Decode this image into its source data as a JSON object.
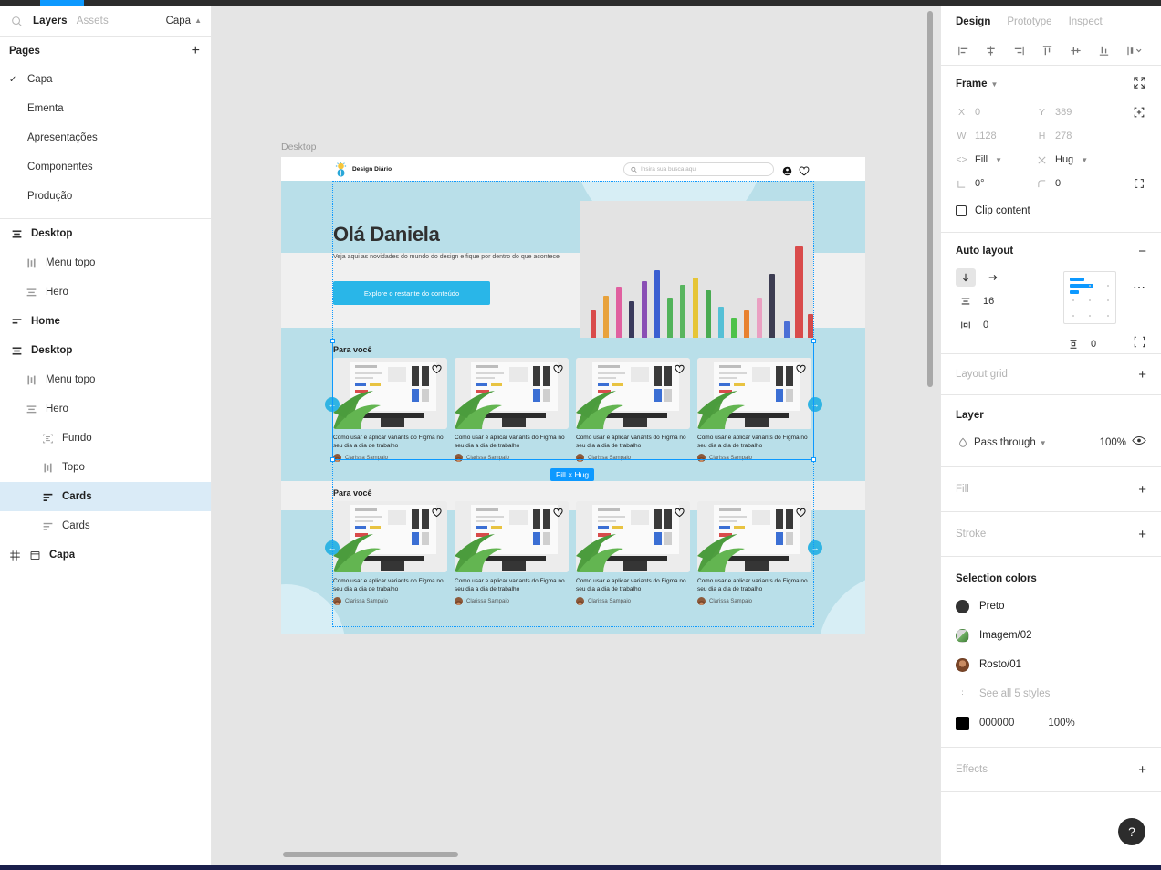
{
  "app": {
    "left_panel": {
      "tabs": [
        {
          "label": "Layers",
          "selected": true
        },
        {
          "label": "Assets",
          "selected": false
        }
      ],
      "page_selector": "Capa",
      "search_icon": "search-icon",
      "pages_title": "Pages",
      "add_page_icon": "plus-icon",
      "pages": [
        {
          "label": "Capa",
          "checked": true
        },
        {
          "label": "Ementa",
          "checked": false
        },
        {
          "label": "Apresentações",
          "checked": false
        },
        {
          "label": "Componentes",
          "checked": false
        },
        {
          "label": "Produção",
          "checked": false
        }
      ],
      "layers": [
        {
          "label": "Desktop",
          "indent": 0,
          "icon": "auto-layout-vertical-icon",
          "bold": true,
          "selected": false
        },
        {
          "label": "Menu topo",
          "indent": 1,
          "icon": "auto-layout-horizontal-icon",
          "bold": false,
          "selected": false
        },
        {
          "label": "Hero",
          "indent": 1,
          "icon": "auto-layout-vertical-icon",
          "bold": false,
          "selected": false
        },
        {
          "label": "Home",
          "indent": 0,
          "icon": "auto-layout-vertical-icon",
          "bold": true,
          "selected": false
        },
        {
          "label": "Desktop",
          "indent": 0,
          "icon": "auto-layout-vertical-icon",
          "bold": true,
          "selected": false
        },
        {
          "label": "Menu topo",
          "indent": 1,
          "icon": "auto-layout-horizontal-icon",
          "bold": false,
          "selected": false
        },
        {
          "label": "Hero",
          "indent": 1,
          "icon": "auto-layout-vertical-icon",
          "bold": false,
          "selected": false
        },
        {
          "label": "Fundo",
          "indent": 2,
          "icon": "component-icon",
          "bold": false,
          "selected": false
        },
        {
          "label": "Topo",
          "indent": 2,
          "icon": "auto-layout-horizontal-icon",
          "bold": false,
          "selected": false
        },
        {
          "label": "Cards",
          "indent": 2,
          "icon": "auto-layout-vertical-icon",
          "bold": true,
          "selected": true
        },
        {
          "label": "Cards",
          "indent": 2,
          "icon": "auto-layout-vertical-icon",
          "bold": false,
          "selected": false
        },
        {
          "label": "Capa",
          "indent": 0,
          "icon": "grid-frame-icon",
          "bold": true,
          "selected": false
        }
      ]
    },
    "canvas": {
      "frame_label": "Desktop",
      "fill_hug_badge": "Fill × Hug",
      "site": {
        "logo_text": "Design Diário",
        "search_placeholder": "Insira sua busca aqui",
        "search_icon": "search-icon",
        "account_icon": "account-circle-icon",
        "favorite_icon": "heart-icon",
        "hero_title": "Olá Daniela",
        "hero_subtitle": "Veja aqui as novidades do mundo do design e fique por dentro do que acontece",
        "hero_cta": "Explore o restante do conteúdo",
        "sections": [
          {
            "title": "Para você",
            "cards": [
              {
                "title": "Como usar e aplicar variants do Figma no seu dia a dia de trabalho",
                "author": "Clarissa Sampaio"
              },
              {
                "title": "Como usar e aplicar variants do Figma no seu dia a dia de trabalho",
                "author": "Clarissa Sampaio"
              },
              {
                "title": "Como usar e aplicar variants do Figma no seu dia a dia de trabalho",
                "author": "Clarissa Sampaio"
              },
              {
                "title": "Como usar e aplicar variants do Figma no seu dia a dia de trabalho",
                "author": "Clarissa Sampaio"
              }
            ],
            "prev_arrow": "←",
            "next_arrow": "→"
          },
          {
            "title": "Para você",
            "cards": [
              {
                "title": "Como usar e aplicar variants do Figma no seu dia a dia de trabalho",
                "author": "Clarissa Sampaio"
              },
              {
                "title": "Como usar e aplicar variants do Figma no seu dia a dia de trabalho",
                "author": "Clarissa Sampaio"
              },
              {
                "title": "Como usar e aplicar variants do Figma no seu dia a dia de trabalho",
                "author": "Clarissa Sampaio"
              },
              {
                "title": "Como usar e aplicar variants do Figma no seu dia a dia de trabalho",
                "author": "Clarissa Sampaio"
              }
            ],
            "prev_arrow": "←",
            "next_arrow": "→"
          }
        ]
      }
    },
    "right_panel": {
      "tabs": [
        {
          "label": "Design",
          "selected": true
        },
        {
          "label": "Prototype",
          "selected": false
        },
        {
          "label": "Inspect",
          "selected": false
        }
      ],
      "align_icons": [
        "align-left-icon",
        "align-horizontal-center-icon",
        "align-right-icon",
        "align-top-icon",
        "align-vertical-center-icon",
        "align-bottom-icon",
        "distribute-icon"
      ],
      "frame": {
        "title": "Frame",
        "collapse_icon": "collapse-icon",
        "x_key": "X",
        "x_val": "0",
        "y_key": "Y",
        "y_val": "389",
        "w_key": "W",
        "w_val": "1128",
        "h_key": "H",
        "h_val": "278",
        "resize_icon": "resize-to-fit-icon",
        "horizontal_resizing": "Fill",
        "vertical_resizing": "Hug",
        "rotation": "0°",
        "corner_radius": "0",
        "independent_corners_icon": "independent-corners-icon",
        "clip_content": "Clip content",
        "clip_content_checked": false
      },
      "auto_layout": {
        "title": "Auto layout",
        "remove_icon": "minus-icon",
        "direction_vertical_icon": "arrow-down-icon",
        "direction_horizontal_icon": "arrow-right-icon",
        "direction_selected": "vertical",
        "gap_icon": "spacing-icon",
        "gap": "16",
        "padding_h_icon": "horizontal-padding-icon",
        "padding_h": "0",
        "padding_v_icon": "vertical-padding-icon",
        "padding_v": "0",
        "more_icon": "more-options-icon",
        "stroke_mode_icon": "clip-content-icon"
      },
      "layout_grid": {
        "title": "Layout grid",
        "add_icon": "plus-icon"
      },
      "layer": {
        "title": "Layer",
        "blend_mode_icon": "blend-mode-icon",
        "blend_mode": "Pass through",
        "opacity": "100%",
        "visibility_icon": "eye-icon"
      },
      "fill": {
        "title": "Fill",
        "add_icon": "plus-icon"
      },
      "stroke": {
        "title": "Stroke",
        "add_icon": "plus-icon"
      },
      "selection_colors": {
        "title": "Selection colors",
        "items": [
          {
            "name": "Preto",
            "swatch": "#333333",
            "type": "solid"
          },
          {
            "name": "Imagem/02",
            "swatch": "#8fae8a",
            "type": "image"
          },
          {
            "name": "Rosto/01",
            "swatch": "#8b5637",
            "type": "image"
          }
        ],
        "see_all": "See all 5 styles",
        "see_all_icon": "more-vertical-icon",
        "raw": {
          "hex": "000000",
          "opacity": "100%",
          "swatch": "#000000"
        }
      },
      "effects": {
        "title": "Effects",
        "add_icon": "plus-icon"
      },
      "help_button": "?"
    },
    "colors": {
      "accent_blue": "#0d99ff",
      "site_blue": "#29b6e8",
      "hero_band": "#b9dfe9",
      "hero_band_light": "#d7eef5",
      "gray_band": "#f0f0f0",
      "canvas_bg": "#e5e5e5",
      "selection_row": "#daebf7"
    }
  }
}
